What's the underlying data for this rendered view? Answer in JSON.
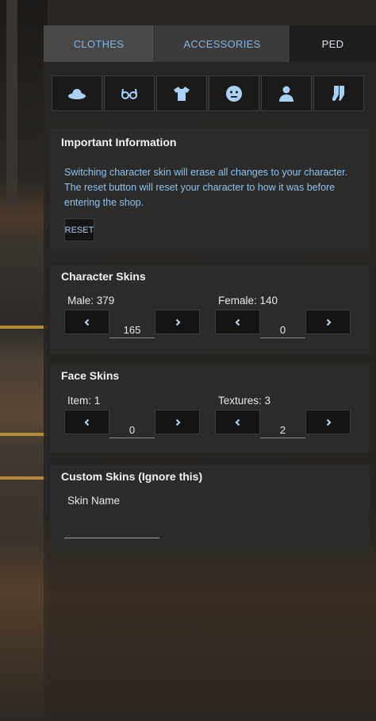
{
  "tabs": [
    {
      "label": "CLOTHES"
    },
    {
      "label": "ACCESSORIES"
    },
    {
      "label": "PED"
    }
  ],
  "categories": [
    {
      "icon": "hat-icon"
    },
    {
      "icon": "glasses-icon"
    },
    {
      "icon": "shirt-icon"
    },
    {
      "icon": "face-icon"
    },
    {
      "icon": "person-icon"
    },
    {
      "icon": "socks-icon"
    }
  ],
  "info": {
    "title": "Important Information",
    "text": "Switching character skin will erase all changes to your character. The reset button will reset your character to how it was before entering the shop.",
    "reset_label": "RESET"
  },
  "character_skins": {
    "title": "Character Skins",
    "male_label": "Male: 379",
    "male_value": "165",
    "female_label": "Female: 140",
    "female_value": "0"
  },
  "face_skins": {
    "title": "Face Skins",
    "item_label": "Item: 1",
    "item_value": "0",
    "textures_label": "Textures: 3",
    "textures_value": "2"
  },
  "custom_skins": {
    "title": "Custom Skins (Ignore this)",
    "skin_name_label": "Skin Name",
    "skin_name_value": ""
  },
  "colors": {
    "accent": "#a9d1f5",
    "text_blue": "#8fc3ee",
    "card_bg": "#2b2b2a"
  }
}
